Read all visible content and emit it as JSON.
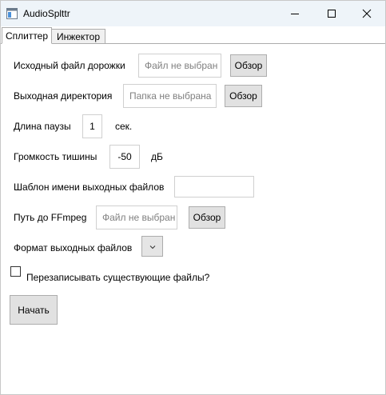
{
  "window": {
    "title": "AudioSplttr"
  },
  "tabs": [
    {
      "label": "Сплиттер",
      "active": true
    },
    {
      "label": "Инжектор",
      "active": false
    }
  ],
  "form": {
    "source_file": {
      "label": "Исходный файл дорожки",
      "placeholder": "Файл не выбран",
      "browse_label": "Обзор"
    },
    "output_dir": {
      "label": "Выходная директория",
      "placeholder": "Папка не выбрана",
      "browse_label": "Обзор"
    },
    "pause_length": {
      "label": "Длина паузы",
      "value": "1",
      "unit": "сек."
    },
    "silence_volume": {
      "label": "Громкость тишины",
      "value": "-50",
      "unit": "дБ"
    },
    "filename_template": {
      "label": "Шаблон имени выходных файлов",
      "value": ""
    },
    "ffmpeg_path": {
      "label": "Путь до FFmpeg",
      "placeholder": "Файл не выбран",
      "browse_label": "Обзор"
    },
    "output_format": {
      "label": "Формат выходных файлов",
      "value": ""
    },
    "overwrite": {
      "label": "Перезаписывать существующие файлы?",
      "checked": false
    },
    "start_label": "Начать"
  },
  "icons": {
    "app": "app-window-icon",
    "minimize": "minimize-icon",
    "maximize": "maximize-icon",
    "close": "close-icon",
    "dropdown": "chevron-down-icon"
  }
}
